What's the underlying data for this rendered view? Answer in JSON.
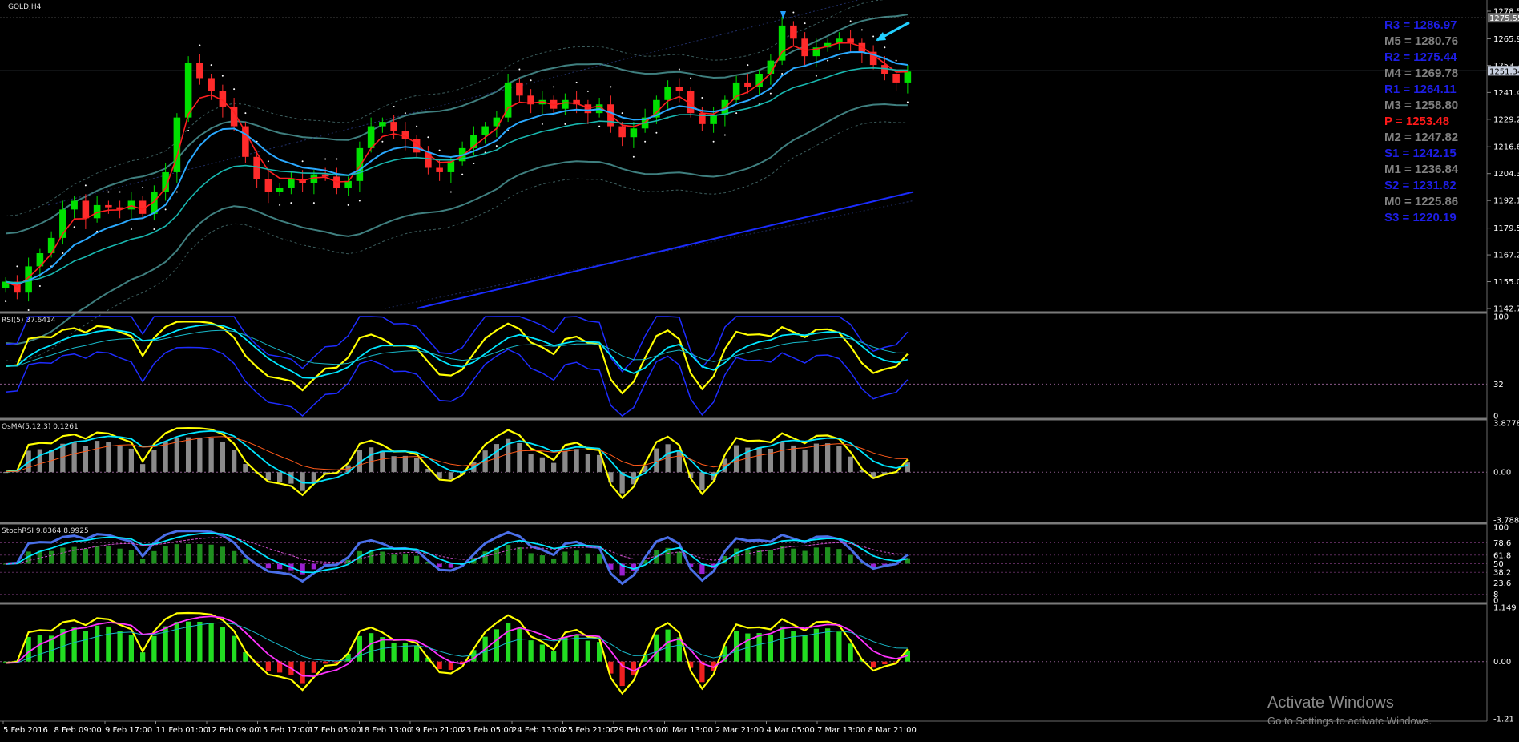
{
  "chart_data": {
    "type": "candlestick",
    "symbol": "GOLD,H4",
    "ylim": [
      1142.75,
      1278.55
    ],
    "y_ticks": [
      "1278.55",
      "1265.95",
      "1253.77",
      "1241.45",
      "1229.20",
      "1216.60",
      "1204.35",
      "1192.10",
      "1179.50",
      "1167.25",
      "1155.00",
      "1142.75"
    ],
    "current_price": "1251.34",
    "last_price_tag": "1275.55",
    "x_ticks": [
      "5 Feb 2016",
      "8 Feb 09:00",
      "9 Feb 17:00",
      "11 Feb 01:00",
      "12 Feb 09:00",
      "15 Feb 17:00",
      "17 Feb 05:00",
      "18 Feb 13:00",
      "19 Feb 21:00",
      "23 Feb 05:00",
      "24 Feb 13:00",
      "25 Feb 21:00",
      "29 Feb 05:00",
      "1 Mar 13:00",
      "2 Mar 21:00",
      "4 Mar 05:00",
      "7 Mar 13:00",
      "8 Mar 21:00"
    ],
    "closes": [
      1155,
      1150,
      1162,
      1168,
      1175,
      1188,
      1192,
      1184,
      1190,
      1189,
      1188,
      1192,
      1186,
      1196,
      1205,
      1230,
      1255,
      1248,
      1242,
      1235,
      1226,
      1212,
      1202,
      1196,
      1198,
      1202,
      1200,
      1204,
      1203,
      1198,
      1201,
      1216,
      1226,
      1228,
      1224,
      1220,
      1214,
      1207,
      1205,
      1210,
      1216,
      1222,
      1226,
      1230,
      1246,
      1240,
      1236,
      1238,
      1234,
      1238,
      1236,
      1232,
      1236,
      1226,
      1221,
      1225,
      1230,
      1238,
      1244,
      1242,
      1232,
      1227,
      1231,
      1238,
      1246,
      1244,
      1250,
      1256,
      1272,
      1266,
      1258,
      1262,
      1264,
      1266,
      1264,
      1260,
      1254,
      1250,
      1246,
      1251
    ],
    "pivots": [
      {
        "label": "R3 = 1286.97",
        "color": "#1e1ee6"
      },
      {
        "label": "M5 = 1280.76",
        "color": "#808080"
      },
      {
        "label": "R2 = 1275.44",
        "color": "#1e1ee6"
      },
      {
        "label": "M4 = 1269.78",
        "color": "#808080"
      },
      {
        "label": "R1 = 1264.11",
        "color": "#1e1ee6"
      },
      {
        "label": "M3 = 1258.80",
        "color": "#808080"
      },
      {
        "label": "P   = 1253.48",
        "color": "#ff1a1a"
      },
      {
        "label": "M2 = 1247.82",
        "color": "#808080"
      },
      {
        "label": "S1 = 1242.15",
        "color": "#1e1ee6"
      },
      {
        "label": "M1 = 1236.84",
        "color": "#808080"
      },
      {
        "label": "S2 = 1231.82",
        "color": "#1e1ee6"
      },
      {
        "label": "M0 = 1225.86",
        "color": "#808080"
      },
      {
        "label": "S3 = 1220.19",
        "color": "#1e1ee6"
      }
    ],
    "panels": [
      {
        "id": "rsi",
        "label": "RSI(5) 37.6414",
        "ylim": [
          0,
          100
        ],
        "ticks": [
          "100",
          "32",
          "0"
        ],
        "level": 32
      },
      {
        "id": "osma",
        "label": "OsMA(5,12,3) 0.1261",
        "ylim": [
          -3.7885,
          3.8778
        ],
        "ticks": [
          "3.8778",
          "0.00",
          "-3.7885"
        ],
        "level": 0
      },
      {
        "id": "stoch",
        "label": "StochRSI 9.8364 8.9925",
        "ylim": [
          0,
          100
        ],
        "ticks": [
          "100",
          "78.6",
          "61.8",
          "50",
          "38.2",
          "23.6",
          "8",
          "0"
        ],
        "levels": [
          78.6,
          61.8,
          50,
          38.2,
          23.6,
          8
        ]
      },
      {
        "id": "macd",
        "label": "",
        "ylim": [
          -1.21,
          1.149
        ],
        "ticks": [
          "1.149",
          "0.00",
          "-1.21"
        ],
        "level": 0
      }
    ]
  },
  "watermark": {
    "line1": "Activate Windows",
    "line2": "Go to Settings to activate Windows."
  },
  "colors": {
    "bull": "#00e000",
    "bear": "#ff2b2b",
    "fast": "#ff2020",
    "slow": "#2aa9ff",
    "band": "#3f7f7f",
    "rsi": "#ffff00",
    "signal": "#00e6ff"
  }
}
